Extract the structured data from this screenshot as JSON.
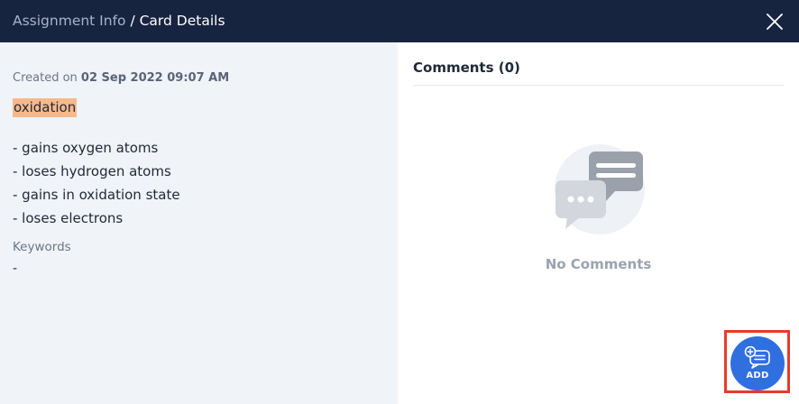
{
  "header": {
    "breadcrumb_parent": "Assignment Info",
    "breadcrumb_separator": " / ",
    "breadcrumb_current": "Card Details",
    "close_icon": "close-icon"
  },
  "card": {
    "created_label": "Created on ",
    "created_date": "02 Sep 2022 09:07 AM",
    "term": "oxidation",
    "definition_lines": [
      "- gains oxygen atoms",
      "- loses hydrogen atoms",
      "- gains in oxidation state",
      "- loses electrons"
    ],
    "keywords_label": "Keywords",
    "keywords_value": "-"
  },
  "comments": {
    "title": "Comments (0)",
    "empty_text": "No Comments",
    "empty_icon": "chat-bubbles-icon"
  },
  "add_button": {
    "label": "ADD",
    "icon": "add-comment-icon"
  },
  "colors": {
    "header_bg": "#172440",
    "left_panel_bg": "#f0f3f8",
    "term_highlight": "#f7b98c",
    "add_button": "#2f6fe0",
    "highlight_box": "#e53b2e"
  }
}
